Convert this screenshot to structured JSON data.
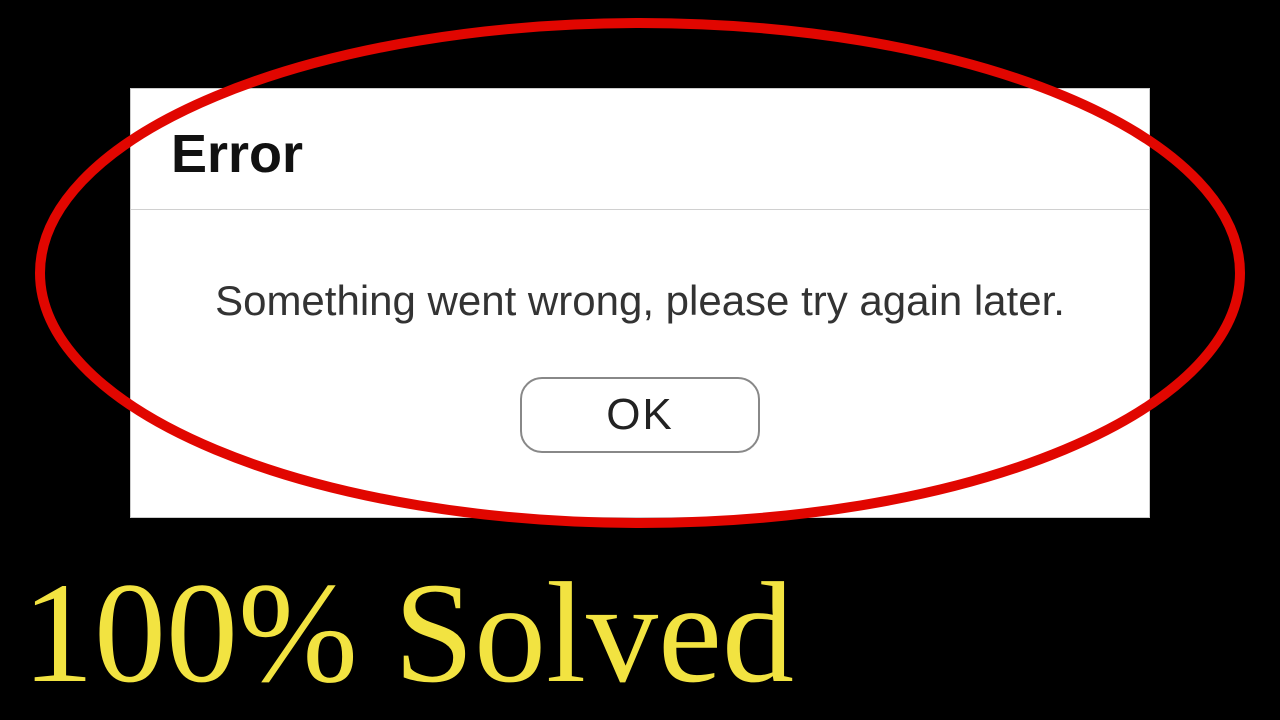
{
  "dialog": {
    "title": "Error",
    "message": "Something went wrong, please try again later.",
    "ok_label": "OK"
  },
  "overlay": {
    "solved_text": "100% Solved",
    "ellipse_color": "#e10600",
    "caption_color": "#f2e341"
  }
}
